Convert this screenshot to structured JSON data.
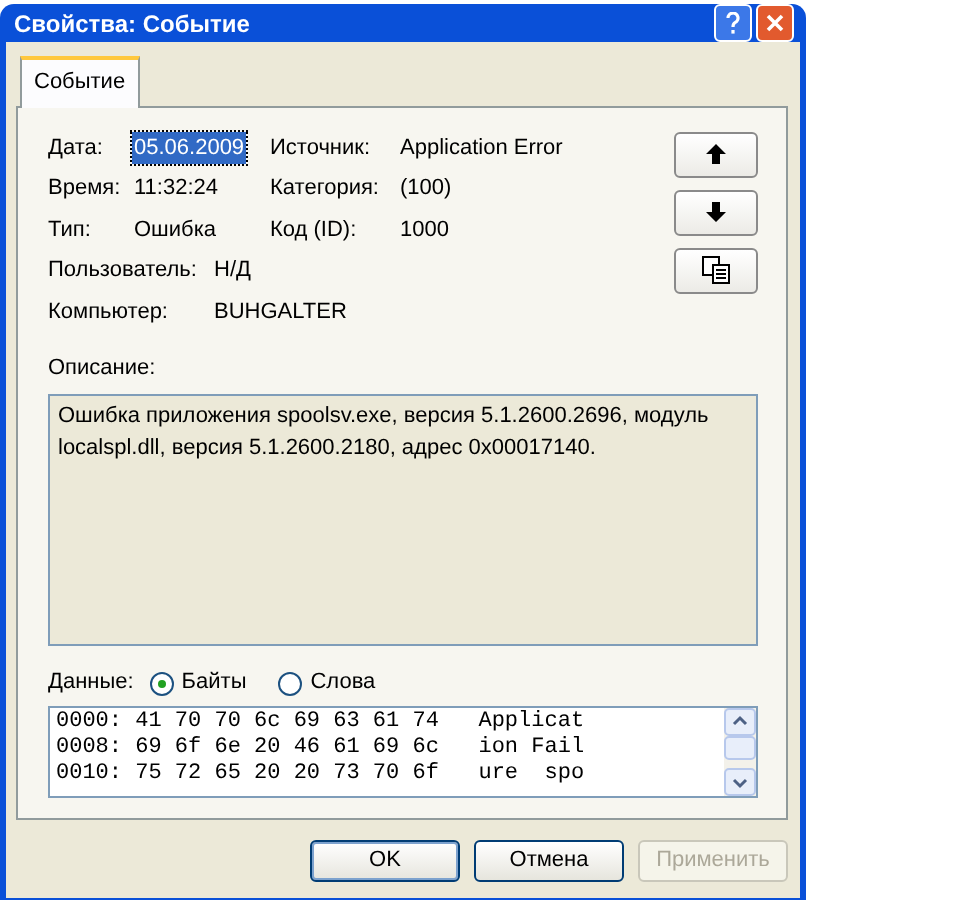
{
  "window": {
    "title": "Свойства: Событие"
  },
  "tabs": [
    {
      "label": "Событие",
      "selected": true
    }
  ],
  "grid_fields": [
    {
      "label": "Дата:",
      "value": "05.06.2009",
      "highlighted": true
    },
    {
      "label": "Источник:",
      "value": "Application Error",
      "highlighted": false
    },
    {
      "label": "Время:",
      "value": "11:32:24",
      "highlighted": false
    },
    {
      "label": "Категория:",
      "value": "(100)",
      "highlighted": false
    },
    {
      "label": "Тип:",
      "value": "Ошибка",
      "highlighted": false
    },
    {
      "label": "Код (ID):",
      "value": "1000",
      "highlighted": false
    }
  ],
  "wide_fields": [
    {
      "label": "Пользователь:",
      "value": "Н/Д"
    },
    {
      "label": "Компьютер:",
      "value": "BUHGALTER"
    }
  ],
  "side_buttons": [
    {
      "kind": "up"
    },
    {
      "kind": "down"
    },
    {
      "kind": "copy"
    }
  ],
  "description": {
    "label": "Описание:",
    "text": "Ошибка приложения spoolsv.exe, версия 5.1.2600.2696, модуль localspl.dll, версия 5.1.2600.2180, адрес 0x00017140."
  },
  "data": {
    "label": "Данные:",
    "options": [
      {
        "label": "Байты",
        "selected": true
      },
      {
        "label": "Слова",
        "selected": false
      }
    ],
    "rows": [
      "0000: 41 70 70 6c 69 63 61 74   Applicat",
      "0008: 69 6f 6e 20 46 61 69 6c   ion Fail",
      "0010: 75 72 65 20 20 73 70 6f   ure  spo"
    ]
  },
  "buttons": [
    {
      "label": "OK",
      "default": true,
      "disabled": false
    },
    {
      "label": "Отмена",
      "default": false,
      "disabled": false
    },
    {
      "label": "Применить",
      "default": false,
      "disabled": true
    }
  ]
}
